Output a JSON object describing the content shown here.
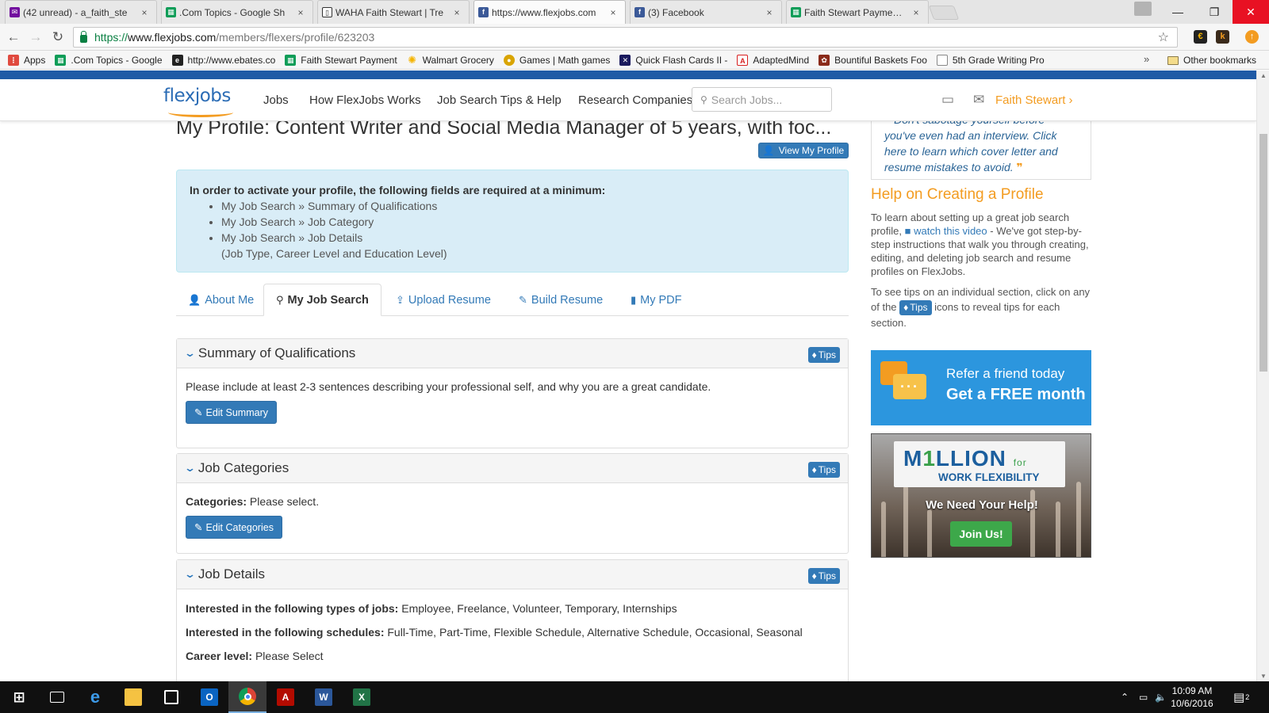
{
  "browser": {
    "tabs": [
      {
        "title": "(42 unread) - a_faith_ste",
        "icon": "yahoo-mail-icon",
        "color": "#720e9e",
        "active": false
      },
      {
        "title": ".Com Topics - Google Sh",
        "icon": "google-sheets-icon",
        "color": "#0f9d58",
        "active": false
      },
      {
        "title": "WAHA Faith Stewart | Tre",
        "icon": "trello-icon",
        "color": "#333333",
        "active": false
      },
      {
        "title": "https://www.flexjobs.com",
        "icon": "facebook-icon",
        "color": "#3b5998",
        "active": true
      },
      {
        "title": "(3) Facebook",
        "icon": "facebook-icon",
        "color": "#3b5998",
        "active": false
      },
      {
        "title": "Faith Stewart Payments_S",
        "icon": "google-sheets-icon",
        "color": "#0f9d58",
        "active": false
      }
    ],
    "close_glyph": "×",
    "url": {
      "https": "https://",
      "host": "www.flexjobs.com",
      "path": "/members/flexers/profile/623203"
    },
    "bookmarks": [
      {
        "label": "Apps",
        "icon": "apps-grid-icon",
        "color": "#e04a3f"
      },
      {
        "label": ".Com Topics - Google",
        "icon": "google-sheets-icon",
        "color": "#0f9d58"
      },
      {
        "label": "http://www.ebates.co",
        "icon": "ebates-icon",
        "color": "#222222"
      },
      {
        "label": "Faith Stewart Payment",
        "icon": "google-sheets-icon",
        "color": "#0f9d58"
      },
      {
        "label": "Walmart Grocery",
        "icon": "walmart-icon",
        "color": "#f5b400"
      },
      {
        "label": "Games | Math games",
        "icon": "games-icon",
        "color": "#d9a400"
      },
      {
        "label": "Quick Flash Cards II -",
        "icon": "flashcards-icon",
        "color": "#1a1a5e"
      },
      {
        "label": "AdaptedMind",
        "icon": "adaptedmind-icon",
        "color": "#d82020"
      },
      {
        "label": "Bountiful Baskets Foo",
        "icon": "baskets-icon",
        "color": "#8a2a1a"
      },
      {
        "label": "5th Grade Writing Pro",
        "icon": "page-icon",
        "color": "#ffffff"
      }
    ],
    "overflow": "»",
    "other_bookmarks": "Other bookmarks"
  },
  "site": {
    "logo": "flexjobs",
    "nav": [
      "Jobs",
      "How FlexJobs Works",
      "Job Search Tips & Help",
      "Research Companies"
    ],
    "search_placeholder": "Search Jobs...",
    "user_name": "Faith Stewart",
    "brand_blue": "#337ab7",
    "brand_orange": "#f39c21"
  },
  "profile": {
    "title": "My Profile: Content Writer and Social Media Manager of 5 years, with foc...",
    "view_button": "View My Profile",
    "alert": {
      "heading": "In order to activate your profile, the following fields are required at a minimum:",
      "items": [
        "My Job Search » Summary of Qualifications",
        "My Job Search » Job Category",
        "My Job Search » Job Details"
      ],
      "note": "(Job Type, Career Level and Education Level)"
    },
    "tabs": [
      {
        "label": "About Me",
        "icon": "user-icon"
      },
      {
        "label": "My Job Search",
        "icon": "search-icon"
      },
      {
        "label": "Upload Resume",
        "icon": "upload-icon"
      },
      {
        "label": "Build Resume",
        "icon": "wrench-icon"
      },
      {
        "label": "My PDF",
        "icon": "file-icon"
      }
    ],
    "tips_label": "Tips",
    "summary": {
      "heading": "Summary of Qualifications",
      "text": "Please include at least 2-3 sentences describing your professional self, and why you are a great candidate.",
      "button": "Edit Summary"
    },
    "categories": {
      "heading": "Job Categories",
      "label": "Categories:",
      "value": "Please select.",
      "button": "Edit Categories"
    },
    "details": {
      "heading": "Job Details",
      "types_label": "Interested in the following types of jobs:",
      "types_value": "Employee, Freelance, Volunteer, Temporary, Internships",
      "schedules_label": "Interested in the following schedules:",
      "schedules_value": "Full-Time, Part-Time, Flexible Schedule, Alternative Schedule, Occasional, Seasonal",
      "career_label": "Career level:",
      "career_value": "Please Select"
    }
  },
  "sidebar": {
    "quote": "Don't sabotage yourself before you've even had an interview. Click here to learn which cover letter and resume mistakes to avoid.",
    "help_heading": "Help on Creating a Profile",
    "help_p1_a": "To learn about setting up a great job search profile,",
    "help_p1_link": "watch this video",
    "help_p1_b": "- We've got step-by-step instructions that walk you through creating, editing, and deleting job search and resume profiles on FlexJobs.",
    "help_p2_a": "To see tips on an individual section, click on any of the",
    "help_p2_b": "icons to reveal tips for each section.",
    "refer_line1": "Refer a friend today",
    "refer_line2": "Get a FREE month",
    "million_m": "M",
    "million_one": "1",
    "million_rest": "LLION",
    "million_for": "for",
    "million_line2": "WORK FLEXIBILITY",
    "million_help": "We Need Your Help!",
    "million_join": "Join Us!"
  },
  "taskbar": {
    "apps": [
      {
        "name": "start-button",
        "icon": "windows-icon"
      },
      {
        "name": "task-view",
        "icon": "task-view-icon"
      },
      {
        "name": "edge",
        "icon": "edge-icon"
      },
      {
        "name": "file-explorer",
        "icon": "folder-icon"
      },
      {
        "name": "store",
        "icon": "store-icon"
      },
      {
        "name": "outlook",
        "icon": "outlook-icon"
      },
      {
        "name": "chrome",
        "icon": "chrome-icon"
      },
      {
        "name": "acrobat",
        "icon": "acrobat-icon"
      },
      {
        "name": "word",
        "icon": "word-icon"
      },
      {
        "name": "excel",
        "icon": "excel-icon"
      }
    ],
    "time": "10:09 AM",
    "date": "10/6/2016",
    "notification_count": "2"
  }
}
